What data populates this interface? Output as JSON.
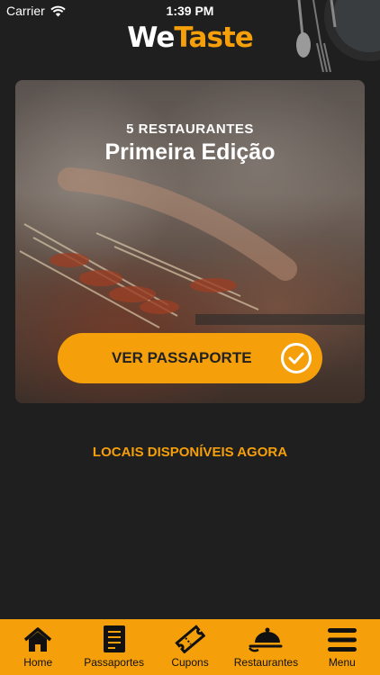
{
  "status_bar": {
    "carrier": "Carrier",
    "time": "1:39 PM"
  },
  "header": {
    "logo_part1": "We",
    "logo_part2": "Taste"
  },
  "hero": {
    "subtitle": "5 RESTAURANTES",
    "title": "Primeira Edição",
    "button_label": "VER PASSAPORTE"
  },
  "section": {
    "title": "LOCAIS DISPONÍVEIS AGORA"
  },
  "tabbar": {
    "items": [
      {
        "label": "Home",
        "icon": "home-icon"
      },
      {
        "label": "Passaportes",
        "icon": "passport-icon"
      },
      {
        "label": "Cupons",
        "icon": "ticket-icon"
      },
      {
        "label": "Restaurantes",
        "icon": "cloche-icon"
      },
      {
        "label": "Menu",
        "icon": "hamburger-menu-icon"
      }
    ]
  },
  "colors": {
    "accent": "#f59f0a",
    "background": "#1f1f1f",
    "battery": "#4cd964"
  }
}
